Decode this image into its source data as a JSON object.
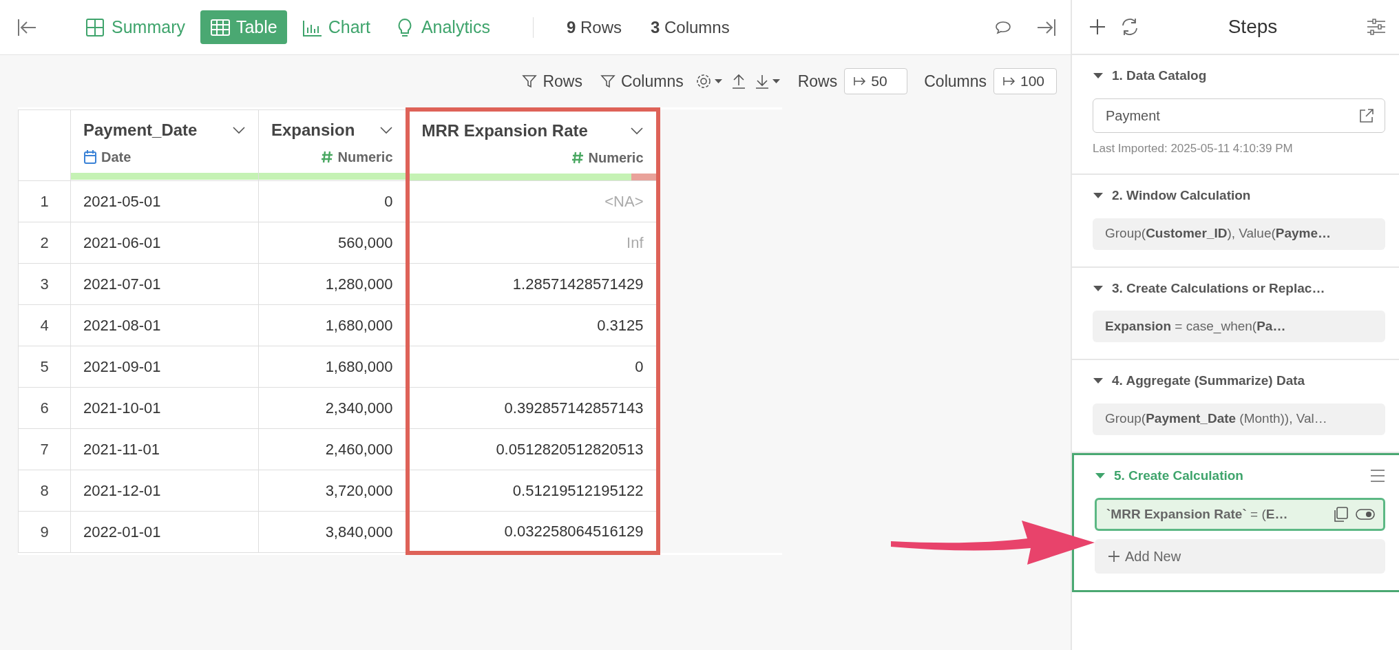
{
  "toolbar": {
    "tabs": [
      {
        "label": "Summary",
        "selected": false
      },
      {
        "label": "Table",
        "selected": true
      },
      {
        "label": "Chart",
        "selected": false
      },
      {
        "label": "Analytics",
        "selected": false
      }
    ],
    "row_count": {
      "number": "9",
      "label": "Rows"
    },
    "column_count": {
      "number": "3",
      "label": "Columns"
    }
  },
  "table_toolbar": {
    "filters": [
      "Rows",
      "Columns"
    ],
    "rows_limit": {
      "label": "Rows",
      "value": "50"
    },
    "columns_limit": {
      "label": "Columns",
      "value": "100"
    }
  },
  "table": {
    "columns": [
      {
        "name": "Payment_Date",
        "type": "Date",
        "kind": "date",
        "level": 1,
        "highlighted": false
      },
      {
        "name": "Expansion",
        "type": "Numeric",
        "kind": "numeric",
        "level": 1,
        "highlighted": false
      },
      {
        "name": "MRR Expansion Rate",
        "type": "Numeric",
        "kind": "numeric",
        "level": 0.9,
        "highlighted": true
      }
    ],
    "rows": [
      {
        "index": "1",
        "cells": [
          {
            "text": "2021-05-01",
            "muted": false
          },
          {
            "text": "0",
            "muted": false
          },
          {
            "text": "<NA>",
            "muted": true
          }
        ]
      },
      {
        "index": "2",
        "cells": [
          {
            "text": "2021-06-01",
            "muted": false
          },
          {
            "text": "560,000",
            "muted": false
          },
          {
            "text": "Inf",
            "muted": true
          }
        ]
      },
      {
        "index": "3",
        "cells": [
          {
            "text": "2021-07-01",
            "muted": false
          },
          {
            "text": "1,280,000",
            "muted": false
          },
          {
            "text": "1.28571428571429",
            "muted": false
          }
        ]
      },
      {
        "index": "4",
        "cells": [
          {
            "text": "2021-08-01",
            "muted": false
          },
          {
            "text": "1,680,000",
            "muted": false
          },
          {
            "text": "0.3125",
            "muted": false
          }
        ]
      },
      {
        "index": "5",
        "cells": [
          {
            "text": "2021-09-01",
            "muted": false
          },
          {
            "text": "1,680,000",
            "muted": false
          },
          {
            "text": "0",
            "muted": false
          }
        ]
      },
      {
        "index": "6",
        "cells": [
          {
            "text": "2021-10-01",
            "muted": false
          },
          {
            "text": "2,340,000",
            "muted": false
          },
          {
            "text": "0.392857142857143",
            "muted": false
          }
        ]
      },
      {
        "index": "7",
        "cells": [
          {
            "text": "2021-11-01",
            "muted": false
          },
          {
            "text": "2,460,000",
            "muted": false
          },
          {
            "text": "0.0512820512820513",
            "muted": false
          }
        ]
      },
      {
        "index": "8",
        "cells": [
          {
            "text": "2021-12-01",
            "muted": false
          },
          {
            "text": "3,720,000",
            "muted": false
          },
          {
            "text": "0.51219512195122",
            "muted": false
          }
        ]
      },
      {
        "index": "9",
        "cells": [
          {
            "text": "2022-01-01",
            "muted": false
          },
          {
            "text": "3,840,000",
            "muted": false
          },
          {
            "text": "0.032258064516129",
            "muted": false
          }
        ]
      }
    ]
  },
  "steps_panel": {
    "title": "Steps",
    "steps": [
      {
        "title": "1. Data Catalog",
        "kind": "source",
        "expanded": true,
        "selected": false,
        "source": "Payment",
        "note": "Last Imported: 2025-05-11 4:10:39 PM"
      },
      {
        "title": "2. Window Calculation",
        "kind": "summary",
        "expanded": true,
        "selected": false,
        "summary": "Group(**Customer_ID**), Value(**Payme…**"
      },
      {
        "title": "3. Create Calculations or Replac…",
        "kind": "summary",
        "expanded": true,
        "selected": false,
        "summary": "**Expansion** = case_when(**Pa…**"
      },
      {
        "title": "4. Aggregate (Summarize) Data",
        "kind": "summary",
        "expanded": true,
        "selected": false,
        "summary": "Group(**Payment_Date** (Month)), Val…"
      },
      {
        "title": "5. Create Calculation",
        "kind": "list",
        "expanded": true,
        "selected": true,
        "items": [
          {
            "text": "**`MRR Expansion Rate`** = (**E…**",
            "selected": true
          }
        ],
        "add_label": "Add New"
      }
    ]
  }
}
